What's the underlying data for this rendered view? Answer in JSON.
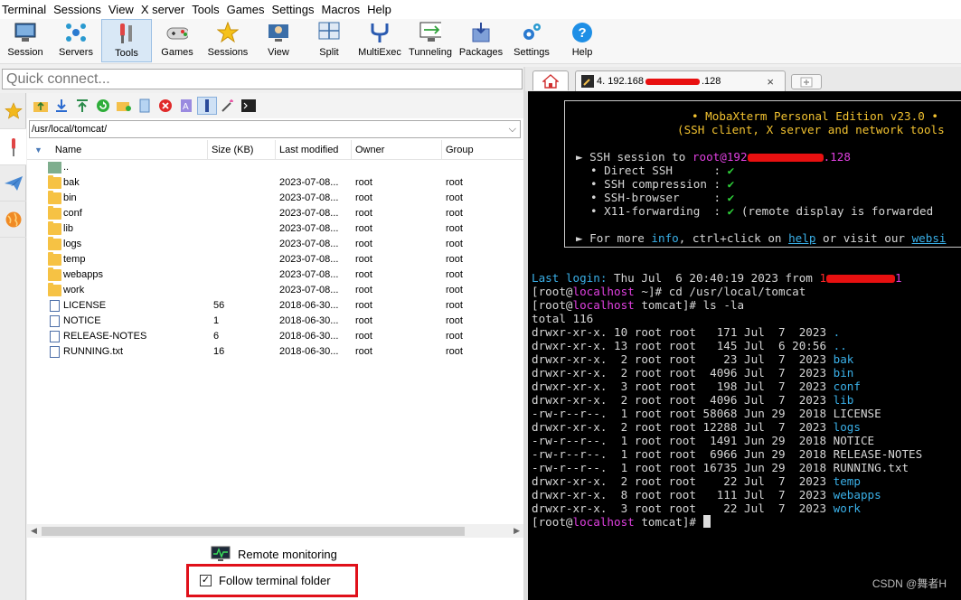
{
  "menu": [
    "Terminal",
    "Sessions",
    "View",
    "X server",
    "Tools",
    "Games",
    "Settings",
    "Macros",
    "Help"
  ],
  "toolbar": [
    {
      "label": "Session",
      "icon": "session-icon"
    },
    {
      "label": "Servers",
      "icon": "servers-icon"
    },
    {
      "label": "Tools",
      "icon": "tools-icon",
      "active": true
    },
    {
      "label": "Games",
      "icon": "games-icon"
    },
    {
      "label": "Sessions",
      "icon": "sessions-star-icon"
    },
    {
      "label": "View",
      "icon": "view-icon"
    },
    {
      "label": "Split",
      "icon": "split-icon"
    },
    {
      "label": "MultiExec",
      "icon": "multiexec-icon"
    },
    {
      "label": "Tunneling",
      "icon": "tunneling-icon"
    },
    {
      "label": "Packages",
      "icon": "packages-icon"
    },
    {
      "label": "Settings",
      "icon": "settings-icon"
    },
    {
      "label": "Help",
      "icon": "help-icon"
    }
  ],
  "quick_connect": {
    "placeholder": "Quick connect..."
  },
  "sftp": {
    "path": "/usr/local/tomcat/",
    "columns": {
      "name": "Name",
      "size": "Size (KB)",
      "modified": "Last modified",
      "owner": "Owner",
      "group": "Group"
    },
    "rows": [
      {
        "type": "up",
        "name": "..",
        "size": "",
        "modified": "",
        "owner": "",
        "group": ""
      },
      {
        "type": "folder",
        "name": "bak",
        "size": "",
        "modified": "2023-07-08...",
        "owner": "root",
        "group": "root"
      },
      {
        "type": "folder",
        "name": "bin",
        "size": "",
        "modified": "2023-07-08...",
        "owner": "root",
        "group": "root"
      },
      {
        "type": "folder",
        "name": "conf",
        "size": "",
        "modified": "2023-07-08...",
        "owner": "root",
        "group": "root"
      },
      {
        "type": "folder",
        "name": "lib",
        "size": "",
        "modified": "2023-07-08...",
        "owner": "root",
        "group": "root"
      },
      {
        "type": "folder",
        "name": "logs",
        "size": "",
        "modified": "2023-07-08...",
        "owner": "root",
        "group": "root"
      },
      {
        "type": "folder",
        "name": "temp",
        "size": "",
        "modified": "2023-07-08...",
        "owner": "root",
        "group": "root"
      },
      {
        "type": "folder",
        "name": "webapps",
        "size": "",
        "modified": "2023-07-08...",
        "owner": "root",
        "group": "root"
      },
      {
        "type": "folder",
        "name": "work",
        "size": "",
        "modified": "2023-07-08...",
        "owner": "root",
        "group": "root"
      },
      {
        "type": "file",
        "name": "LICENSE",
        "size": "56",
        "modified": "2018-06-30...",
        "owner": "root",
        "group": "root"
      },
      {
        "type": "file",
        "name": "NOTICE",
        "size": "1",
        "modified": "2018-06-30...",
        "owner": "root",
        "group": "root"
      },
      {
        "type": "file",
        "name": "RELEASE-NOTES",
        "size": "6",
        "modified": "2018-06-30...",
        "owner": "root",
        "group": "root"
      },
      {
        "type": "file",
        "name": "RUNNING.txt",
        "size": "16",
        "modified": "2018-06-30...",
        "owner": "root",
        "group": "root"
      }
    ],
    "remote_monitoring": "Remote monitoring",
    "follow_terminal_folder": "Follow terminal folder",
    "follow_checked": true
  },
  "tabs": {
    "ssh_tab_label": "4. 192.168",
    "ssh_tab_suffix": ".128",
    "close": "×"
  },
  "terminal": {
    "banner_title": "• MobaXterm Personal Edition v23.0 •",
    "banner_sub": "(SSH client, X server and network tools",
    "ssh_session_prefix": "SSH session to ",
    "ssh_user": "root@192",
    "ssh_user_suffix": ".128",
    "features": [
      {
        "name": "Direct SSH      :",
        "value": "✔"
      },
      {
        "name": "SSH compression :",
        "value": "✔"
      },
      {
        "name": "SSH-browser     :",
        "value": "✔"
      },
      {
        "name": "X11-forwarding  :",
        "value": "✔",
        "extra": " (remote display is forwarded"
      }
    ],
    "more_info": {
      "p1": "For more ",
      "info": "info",
      "p2": ", ctrl+click on ",
      "help": "help",
      "p3": " or visit our ",
      "web": "websi"
    },
    "last_login_label": "Last login:",
    "last_login_text": " Thu Jul  6 20:40:19 2023 from ",
    "last_login_ip_tail": "1",
    "prompt_user": "localhost",
    "cmd1_dir": "~",
    "cmd1": "cd /usr/local/tomcat",
    "cmd2_dir": "tomcat",
    "cmd2": "ls -la",
    "total": "total 116",
    "listing": [
      {
        "meta": "drwxr-xr-x. 10 root root   171 Jul  7  2023 ",
        "name": ".",
        "dir": true
      },
      {
        "meta": "drwxr-xr-x. 13 root root   145 Jul  6 20:56 ",
        "name": "..",
        "dir": true
      },
      {
        "meta": "drwxr-xr-x.  2 root root    23 Jul  7  2023 ",
        "name": "bak",
        "dir": true
      },
      {
        "meta": "drwxr-xr-x.  2 root root  4096 Jul  7  2023 ",
        "name": "bin",
        "dir": true
      },
      {
        "meta": "drwxr-xr-x.  3 root root   198 Jul  7  2023 ",
        "name": "conf",
        "dir": true
      },
      {
        "meta": "drwxr-xr-x.  2 root root  4096 Jul  7  2023 ",
        "name": "lib",
        "dir": true
      },
      {
        "meta": "-rw-r--r--.  1 root root 58068 Jun 29  2018 ",
        "name": "LICENSE",
        "dir": false
      },
      {
        "meta": "drwxr-xr-x.  2 root root 12288 Jul  7  2023 ",
        "name": "logs",
        "dir": true
      },
      {
        "meta": "-rw-r--r--.  1 root root  1491 Jun 29  2018 ",
        "name": "NOTICE",
        "dir": false
      },
      {
        "meta": "-rw-r--r--.  1 root root  6966 Jun 29  2018 ",
        "name": "RELEASE-NOTES",
        "dir": false
      },
      {
        "meta": "-rw-r--r--.  1 root root 16735 Jun 29  2018 ",
        "name": "RUNNING.txt",
        "dir": false
      },
      {
        "meta": "drwxr-xr-x.  2 root root    22 Jul  7  2023 ",
        "name": "temp",
        "dir": true
      },
      {
        "meta": "drwxr-xr-x.  8 root root   111 Jul  7  2023 ",
        "name": "webapps",
        "dir": true
      },
      {
        "meta": "drwxr-xr-x.  3 root root    22 Jul  7  2023 ",
        "name": "work",
        "dir": true
      }
    ],
    "watermark": "CSDN @舞者H"
  },
  "colors": {
    "accent": "#3ab0e8",
    "highlight_box": "#e0101a",
    "terminal_bg": "#000000",
    "prompt_host": "#e040e0"
  }
}
